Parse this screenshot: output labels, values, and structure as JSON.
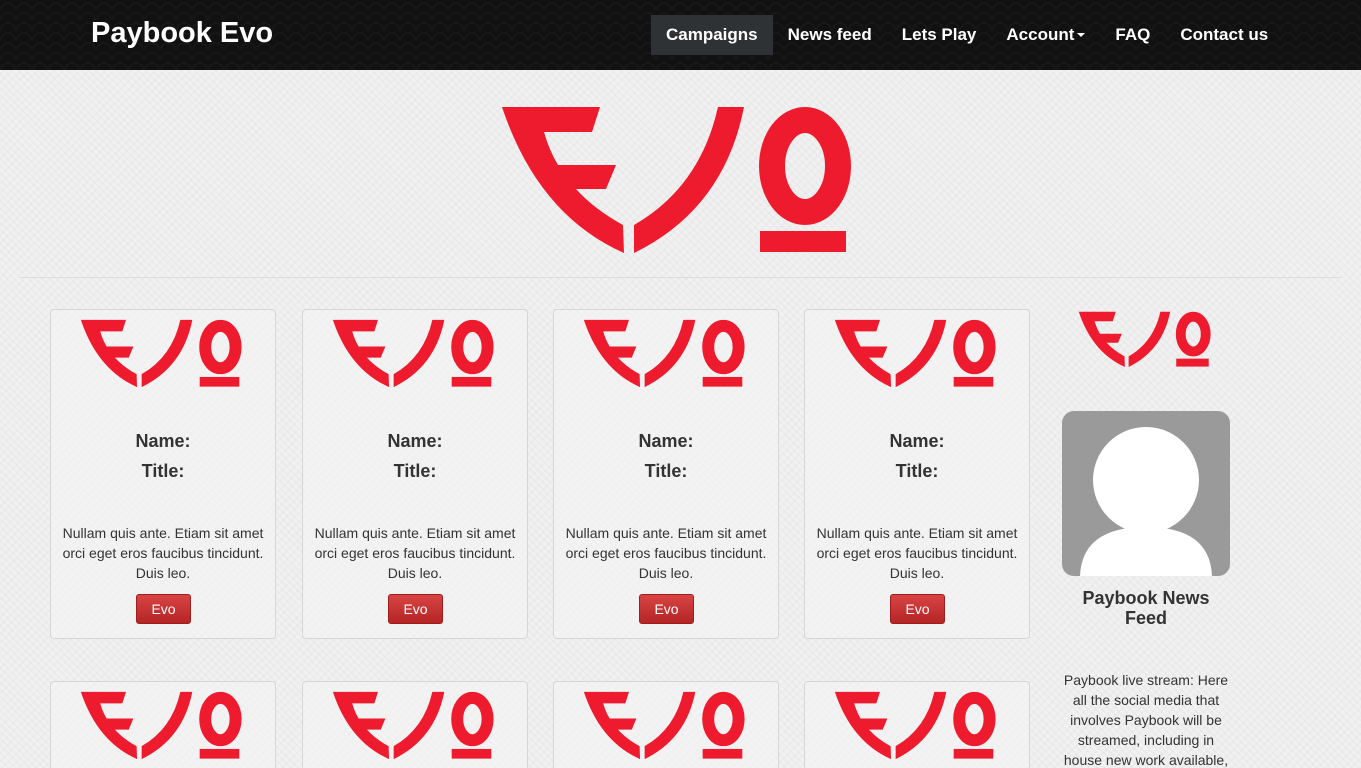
{
  "navbar": {
    "brand": "Paybook Evo",
    "items": [
      {
        "label": "Campaigns",
        "active": true
      },
      {
        "label": "News feed"
      },
      {
        "label": "Lets Play"
      },
      {
        "label": "Account",
        "dropdown": true
      },
      {
        "label": "FAQ"
      },
      {
        "label": "Contact us"
      }
    ]
  },
  "brand_color": "#ee1b2e",
  "cards": [
    {
      "name": "Name:",
      "title": "Title:",
      "text": "Nullam quis ante. Etiam sit amet orci eget eros faucibus tincidunt. Duis leo.",
      "button": "Evo"
    },
    {
      "name": "Name:",
      "title": "Title:",
      "text": "Nullam quis ante. Etiam sit amet orci eget eros faucibus tincidunt. Duis leo.",
      "button": "Evo"
    },
    {
      "name": "Name:",
      "title": "Title:",
      "text": "Nullam quis ante. Etiam sit amet orci eget eros faucibus tincidunt. Duis leo.",
      "button": "Evo"
    },
    {
      "name": "Name:",
      "title": "Title:",
      "text": "Nullam quis ante. Etiam sit amet orci eget eros faucibus tincidunt. Duis leo.",
      "button": "Evo"
    }
  ],
  "sidebar": {
    "title": "Paybook News Feed",
    "text": "Paybook live stream: Here all the social media that involves Paybook will be streamed, including in house new work available,"
  }
}
